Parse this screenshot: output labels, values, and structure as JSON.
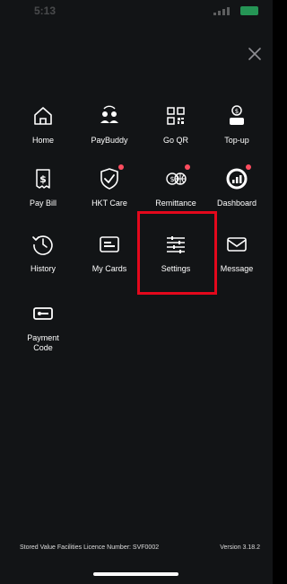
{
  "status": {
    "time": "5:13"
  },
  "menu": {
    "items": [
      {
        "label": "Home",
        "icon": "home-icon"
      },
      {
        "label": "PayBuddy",
        "icon": "paybuddy-icon"
      },
      {
        "label": "Go QR",
        "icon": "qr-icon"
      },
      {
        "label": "Top-up",
        "icon": "topup-icon"
      },
      {
        "label": "Pay Bill",
        "icon": "pay-bill-icon"
      },
      {
        "label": "HKT Care",
        "icon": "shield-check-icon"
      },
      {
        "label": "Remittance",
        "icon": "remittance-icon"
      },
      {
        "label": "Dashboard",
        "icon": "dashboard-icon"
      },
      {
        "label": "History",
        "icon": "history-icon"
      },
      {
        "label": "My Cards",
        "icon": "cards-icon"
      },
      {
        "label": "Settings",
        "icon": "settings-icon"
      },
      {
        "label": "Message",
        "icon": "message-icon"
      },
      {
        "label": "Payment Code",
        "icon": "payment-code-icon"
      }
    ]
  },
  "footer": {
    "licence": "Stored Value Facilities Licence Number: SVF0002",
    "version": "Version 3.18.2"
  },
  "colors": {
    "background": "#121416",
    "text": "#ffffff",
    "highlight": "#e3081c",
    "badge": "#ff4d5f"
  }
}
